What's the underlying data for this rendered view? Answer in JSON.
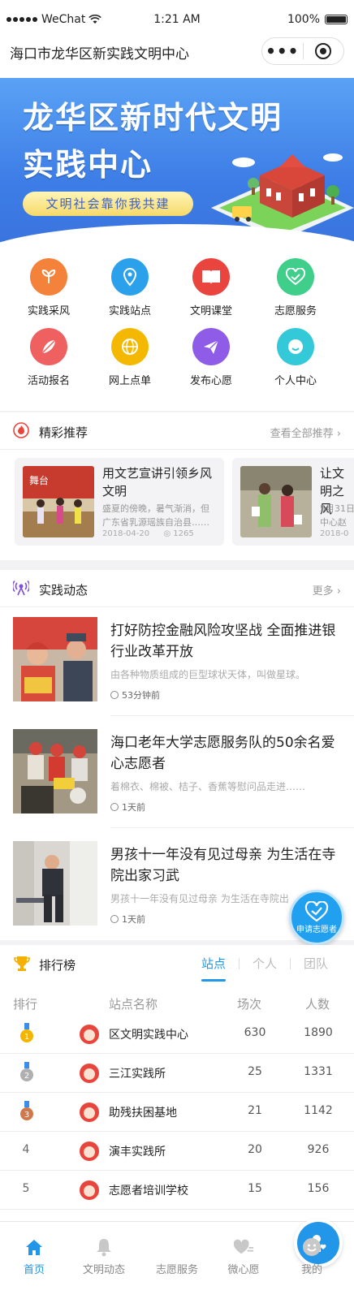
{
  "status": {
    "carrier": "WeChat",
    "time": "1:21 AM",
    "battery": "100%"
  },
  "nav": {
    "title": "海口市龙华区新实践文明中心",
    "more": "•••"
  },
  "banner": {
    "line1": "龙华区新时代文明",
    "line2": "实践中心",
    "slogan": "文明社会靠你我共建"
  },
  "grid": [
    {
      "label": "实践采风",
      "icon": "leaf-icon",
      "color": "#f4823a"
    },
    {
      "label": "实践站点",
      "icon": "location-icon",
      "color": "#2ba1ec"
    },
    {
      "label": "文明课堂",
      "icon": "book-icon",
      "color": "#e9443e"
    },
    {
      "label": "志愿服务",
      "icon": "heart-hands-icon",
      "color": "#3fcf8b"
    },
    {
      "label": "活动报名",
      "icon": "signup-icon",
      "color": "#ef6060"
    },
    {
      "label": "网上点单",
      "icon": "globe-icon",
      "color": "#f5b800"
    },
    {
      "label": "发布心愿",
      "icon": "paper-plane-icon",
      "color": "#8e5ce6"
    },
    {
      "label": "个人中心",
      "icon": "smile-icon",
      "color": "#34c9d8"
    }
  ],
  "recommend": {
    "title": "精彩推荐",
    "more": "查看全部推荐 ›",
    "cards": [
      {
        "title": "用文艺宣讲引领乡风文明",
        "desc": "盛夏的傍晚，暑气渐消，但广东省乳源瑶族自治县……",
        "date": "2018-04-20",
        "views": "1265"
      },
      {
        "title": "让文明之风",
        "desc": "5月31日中心赵",
        "date": "2018-0",
        "views": ""
      }
    ]
  },
  "practice": {
    "title": "实践动态",
    "more": "更多 ›",
    "items": [
      {
        "title": "打好防控金融风险攻坚战 全面推进银行业改革开放",
        "desc": "由各种物质组成的巨型球状天体，叫做星球。",
        "time": "53分钟前"
      },
      {
        "title": "海口老年大学志愿服务队的50余名爱心志愿者",
        "desc": "着棉衣、棉被、桔子、香蕉等慰问品走进……",
        "time": "1天前"
      },
      {
        "title": "男孩十一年没有见过母亲 为生活在寺院出家习武",
        "desc": "男孩十一年没有见过母亲 为生活在寺院出",
        "time": "1天前"
      }
    ]
  },
  "ranking": {
    "title": "排行榜",
    "tabs": [
      "站点",
      "个人",
      "团队"
    ],
    "headers": {
      "rank": "排行",
      "name": "站点名称",
      "times": "场次",
      "count": "人数"
    },
    "rows": [
      {
        "rank": "1",
        "name": "区文明实践中心",
        "times": "630",
        "count": "1890",
        "medal": "#f4b400"
      },
      {
        "rank": "2",
        "name": "三江实践所",
        "times": "25",
        "count": "1331",
        "medal": "#b0b0b0"
      },
      {
        "rank": "3",
        "name": "助残扶困基地",
        "times": "21",
        "count": "1142",
        "medal": "#d0784c"
      },
      {
        "rank": "4",
        "name": "演丰实践所",
        "times": "20",
        "count": "926"
      },
      {
        "rank": "5",
        "name": "志愿者培训学校",
        "times": "15",
        "count": "156"
      }
    ]
  },
  "float": {
    "label": "申请志愿者"
  },
  "tabbar": [
    {
      "label": "首页",
      "icon": "home-icon",
      "active": true
    },
    {
      "label": "文明动态",
      "icon": "bell-icon"
    },
    {
      "label": "志愿服务",
      "icon": "volunteer-icon"
    },
    {
      "label": "微心愿",
      "icon": "wish-icon"
    },
    {
      "label": "我的",
      "icon": "profile-icon"
    }
  ]
}
